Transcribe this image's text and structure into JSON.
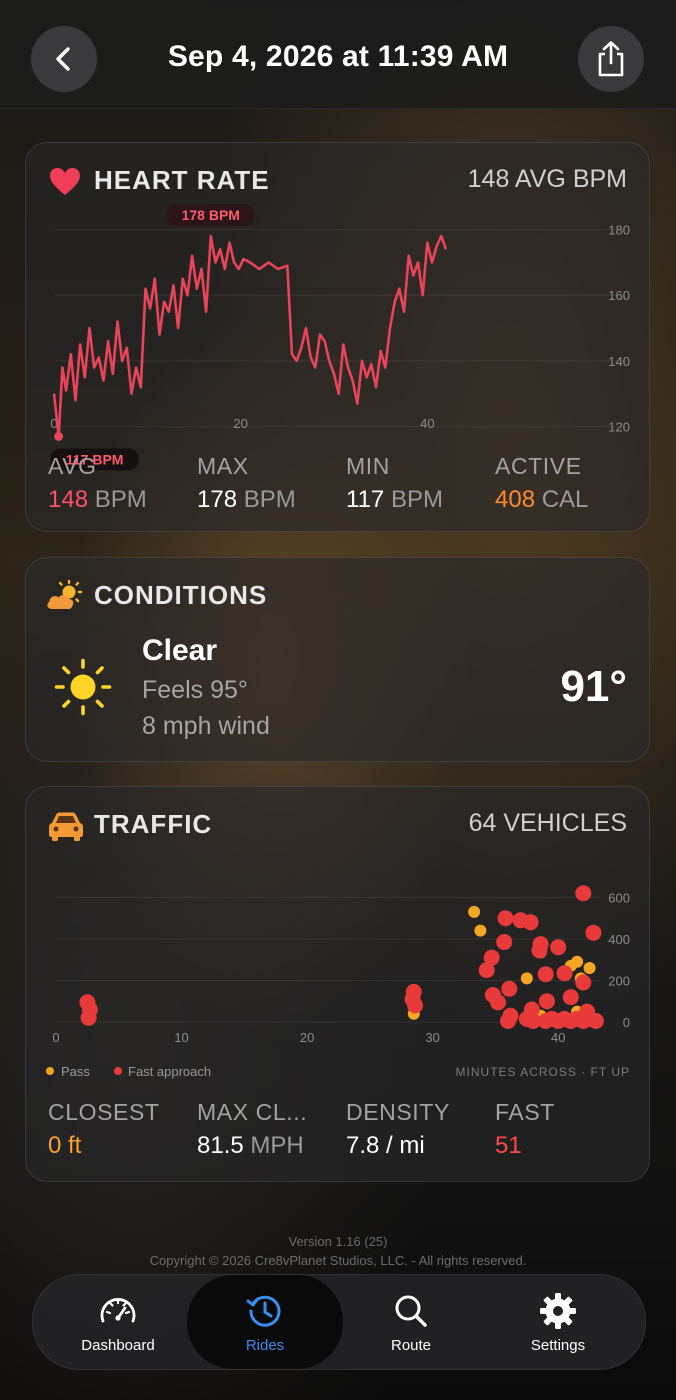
{
  "header": {
    "title": "Sep 4, 2026 at 11:39 AM",
    "back_icon": "chevron-left-icon",
    "share_icon": "share-icon"
  },
  "heart_rate": {
    "title": "HEART RATE",
    "summary": "148 AVG BPM",
    "accent": "#e8445a",
    "max_label": "178 BPM",
    "min_label": "117 BPM",
    "stats": [
      {
        "label": "AVG",
        "value": "148",
        "unit": "BPM",
        "color": "#ff5268"
      },
      {
        "label": "MAX",
        "value": "178",
        "unit": "BPM",
        "color": "#ffffff"
      },
      {
        "label": "MIN",
        "value": "117",
        "unit": "BPM",
        "color": "#ffffff"
      },
      {
        "label": "ACTIVE",
        "value": "408",
        "unit": "CAL",
        "color": "#ff8a2a"
      }
    ]
  },
  "conditions": {
    "title": "CONDITIONS",
    "summary": "Clear",
    "feels": "Feels 95°",
    "wind": "8 mph wind",
    "temp": "91°",
    "icon": "sun-icon"
  },
  "traffic": {
    "title": "TRAFFIC",
    "summary": "64 VEHICLES",
    "legend": {
      "pass": "Pass",
      "fast": "Fast approach",
      "pass_color": "#f5a623",
      "fast_color": "#e83a3a"
    },
    "axis_caption": "MINUTES ACROSS · FT UP",
    "stats": [
      {
        "label": "CLOSEST",
        "value": "0 ft",
        "unit": "",
        "color": "#ff9f2e"
      },
      {
        "label": "MAX CL...",
        "value": "81.5",
        "unit": "MPH",
        "color": "#ffffff"
      },
      {
        "label": "DENSITY",
        "value": "7.8 / mi",
        "unit": "",
        "color": "#ffffff"
      },
      {
        "label": "FAST",
        "value": "51",
        "unit": "",
        "color": "#ff4a4a"
      }
    ]
  },
  "footer": {
    "version": "Version 1.16 (25)",
    "copyright": "Copyright © 2026 Cre8vPlanet Studios, LLC. - All rights reserved."
  },
  "tabs": [
    {
      "label": "Dashboard",
      "icon": "speedometer-icon"
    },
    {
      "label": "Rides",
      "icon": "history-clock-icon"
    },
    {
      "label": "Route",
      "icon": "search-icon"
    },
    {
      "label": "Settings",
      "icon": "gear-icon"
    }
  ],
  "chart_data": [
    {
      "type": "line",
      "title": "HEART RATE",
      "xlabel": "",
      "ylabel": "",
      "xlim": [
        0,
        42
      ],
      "ylim": [
        115,
        182
      ],
      "xticks": [
        "0",
        "20",
        "40"
      ],
      "yticks": [
        "120",
        "140",
        "160",
        "180"
      ],
      "grid": true,
      "series": [
        {
          "color": "#e8445a",
          "x": [
            0,
            0.5,
            0.9,
            1.3,
            1.8,
            2.3,
            2.8,
            3.3,
            3.8,
            4.3,
            4.8,
            5.3,
            5.8,
            6.3,
            6.8,
            7.3,
            7.8,
            8.3,
            8.8,
            9.3,
            9.8,
            10.3,
            10.8,
            11.3,
            11.8,
            12.3,
            12.8,
            13.3,
            13.8,
            14.3,
            14.8,
            15.3,
            15.8,
            16.3,
            16.8,
            17.3,
            17.8,
            18.3,
            18.8,
            19.3,
            19.8,
            20.3,
            21,
            22,
            23,
            24,
            25,
            25.5,
            26,
            26.5,
            27,
            27.5,
            28,
            28.5,
            29,
            29.5,
            30,
            30.5,
            31,
            31.5,
            32,
            32.5,
            33,
            33.5,
            34,
            34.5,
            35,
            35.5,
            36,
            36.5,
            37,
            37.5,
            38,
            38.5,
            39,
            39.5,
            40,
            40.5,
            41,
            41.5,
            42
          ],
          "values": [
            130,
            117,
            138,
            131,
            142,
            128,
            145,
            135,
            150,
            138,
            141,
            134,
            146,
            136,
            152,
            140,
            144,
            130,
            138,
            132,
            162,
            156,
            165,
            148,
            158,
            155,
            163,
            150,
            165,
            160,
            172,
            162,
            168,
            155,
            178,
            170,
            174,
            168,
            176,
            170,
            168,
            171,
            170,
            168,
            170,
            168,
            169,
            142,
            140,
            144,
            150,
            141,
            138,
            148,
            146,
            140,
            136,
            130,
            145,
            138,
            134,
            127,
            140,
            135,
            139,
            132,
            143,
            138,
            150,
            158,
            162,
            155,
            172,
            166,
            170,
            160,
            176,
            170,
            175,
            178,
            174
          ]
        }
      ]
    },
    {
      "type": "scatter",
      "title": "TRAFFIC",
      "xlabel": "MINUTES ACROSS",
      "ylabel": "FT UP",
      "xlim": [
        0,
        45
      ],
      "ylim": [
        0,
        650
      ],
      "xticks": [
        "0",
        "10",
        "20",
        "30",
        "40"
      ],
      "yticks": [
        "0",
        "200",
        "400",
        "600"
      ],
      "grid": true,
      "series": [
        {
          "name": "Pass",
          "color": "#f5a623",
          "points": [
            [
              28.5,
              40
            ],
            [
              33.3,
              530
            ],
            [
              33.8,
              440
            ],
            [
              38.6,
              30
            ],
            [
              41.5,
              50
            ],
            [
              38.6,
              335
            ],
            [
              41,
              270
            ],
            [
              41.5,
              290
            ],
            [
              42.5,
              260
            ],
            [
              41.8,
              210
            ],
            [
              37.5,
              210
            ]
          ]
        },
        {
          "name": "Fast approach",
          "color": "#e83a3a",
          "points": [
            [
              2.5,
              95
            ],
            [
              2.7,
              60
            ],
            [
              2.6,
              20
            ],
            [
              28.5,
              145
            ],
            [
              28.4,
              110
            ],
            [
              28.6,
              80
            ],
            [
              42,
              620
            ],
            [
              35.8,
              500
            ],
            [
              37,
              490
            ],
            [
              37.8,
              480
            ],
            [
              42.8,
              430
            ],
            [
              38.6,
              375
            ],
            [
              35.7,
              385
            ],
            [
              38.5,
              345
            ],
            [
              40,
              360
            ],
            [
              34.7,
              310
            ],
            [
              34.3,
              250
            ],
            [
              39,
              230
            ],
            [
              40.5,
              235
            ],
            [
              36.1,
              160
            ],
            [
              42,
              190
            ],
            [
              34.8,
              130
            ],
            [
              35.2,
              95
            ],
            [
              39.1,
              100
            ],
            [
              41,
              120
            ],
            [
              36.2,
              30
            ],
            [
              36,
              5
            ],
            [
              38,
              5
            ],
            [
              39,
              5
            ],
            [
              40,
              5
            ],
            [
              41,
              5
            ],
            [
              42,
              5
            ],
            [
              43,
              5
            ],
            [
              37.5,
              15
            ],
            [
              39.5,
              15
            ],
            [
              40.5,
              15
            ],
            [
              41.5,
              15
            ],
            [
              42.5,
              15
            ],
            [
              37.9,
              60
            ],
            [
              42.3,
              50
            ]
          ]
        }
      ]
    }
  ]
}
